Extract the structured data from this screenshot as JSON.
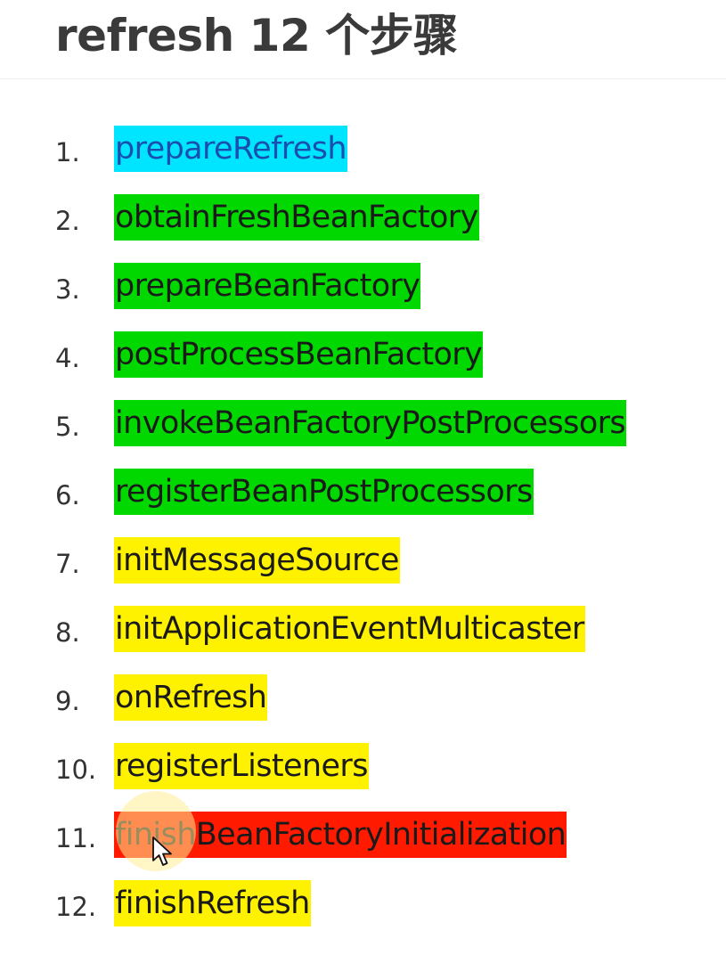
{
  "page": {
    "title": "refresh 12 个步骤"
  },
  "colors": {
    "cyan": "#00e5ff",
    "green": "#00d800",
    "yellow": "#fff200",
    "red": "#ff1a00"
  },
  "steps": [
    {
      "number": "1.",
      "name": "prepareRefresh",
      "highlight": "cyan"
    },
    {
      "number": "2.",
      "name": "obtainFreshBeanFactory",
      "highlight": "green"
    },
    {
      "number": "3.",
      "name": "prepareBeanFactory",
      "highlight": "green"
    },
    {
      "number": "4.",
      "name": "postProcessBeanFactory",
      "highlight": "green"
    },
    {
      "number": "5.",
      "name": "invokeBeanFactoryPostProcessors",
      "highlight": "green"
    },
    {
      "number": "6.",
      "name": "registerBeanPostProcessors",
      "highlight": "green"
    },
    {
      "number": "7.",
      "name": "initMessageSource",
      "highlight": "yellow"
    },
    {
      "number": "8.",
      "name": "initApplicationEventMulticaster",
      "highlight": "yellow"
    },
    {
      "number": "9.",
      "name": "onRefresh",
      "highlight": "yellow"
    },
    {
      "number": "10.",
      "name": "registerListeners",
      "highlight": "yellow"
    },
    {
      "number": "11.",
      "name": "finishBeanFactoryInitialization",
      "highlight": "red"
    },
    {
      "number": "12.",
      "name": "finishRefresh",
      "highlight": "yellow"
    }
  ],
  "cursor": {
    "icon": "mouse-pointer-icon"
  }
}
